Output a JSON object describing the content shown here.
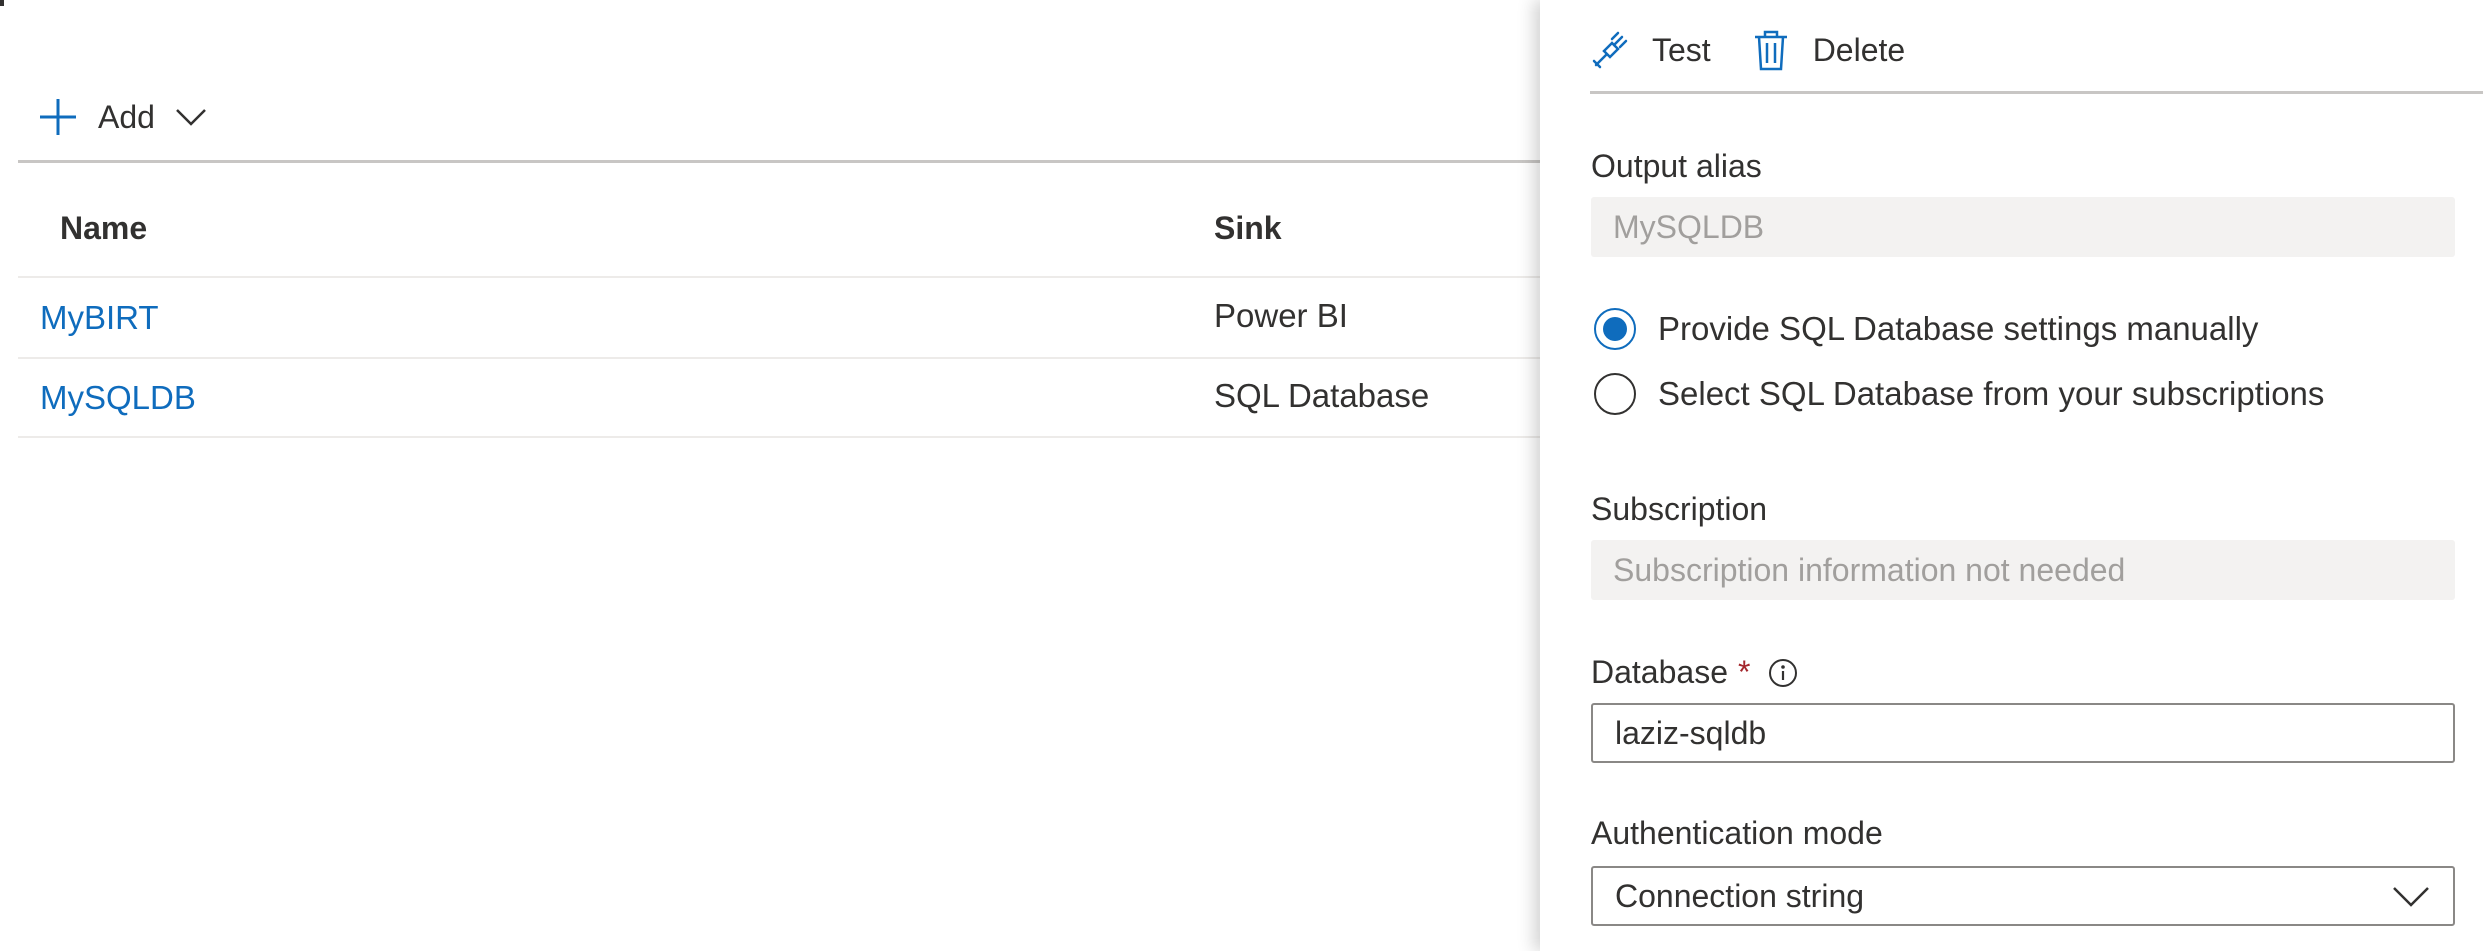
{
  "list": {
    "add_label": "Add",
    "columns": {
      "name": "Name",
      "sink": "Sink"
    },
    "rows": [
      {
        "name": "MyBIRT",
        "sink": "Power BI"
      },
      {
        "name": "MySQLDB",
        "sink": "SQL Database"
      }
    ]
  },
  "panel": {
    "toolbar": {
      "test_label": "Test",
      "delete_label": "Delete"
    },
    "output_alias": {
      "label": "Output alias",
      "value": "MySQLDB"
    },
    "radio_options": [
      {
        "label": "Provide SQL Database settings manually",
        "checked": true
      },
      {
        "label": "Select SQL Database from your subscriptions",
        "checked": false
      }
    ],
    "subscription": {
      "label": "Subscription",
      "value": "Subscription information not needed"
    },
    "database": {
      "label": "Database",
      "required_mark": "*",
      "value": "laziz-sqldb"
    },
    "auth_mode": {
      "label": "Authentication mode",
      "value": "Connection string"
    }
  },
  "colors": {
    "accent": "#0f6cbd",
    "required": "#a4262c",
    "disabled_bg": "#f3f2f1",
    "text": "#323130"
  },
  "icons": [
    "plus-icon",
    "chevron-down-icon",
    "plug-icon",
    "trash-icon",
    "info-icon"
  ]
}
